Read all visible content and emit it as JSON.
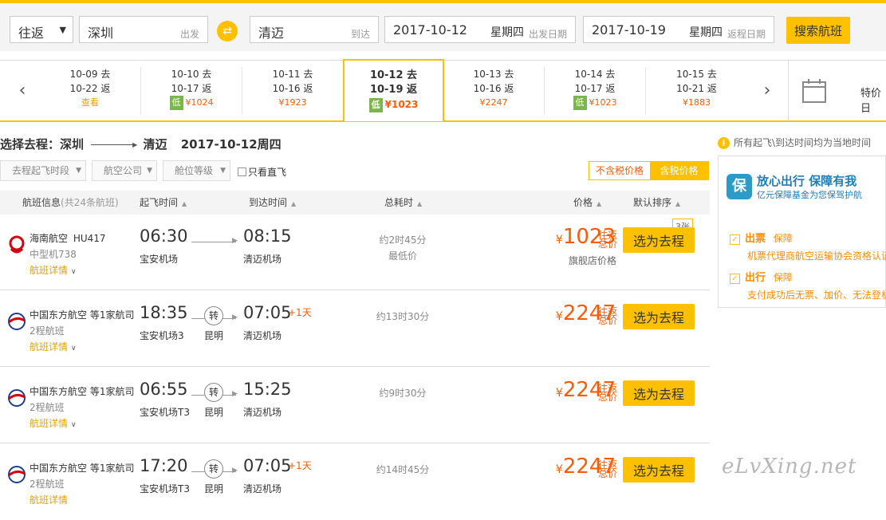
{
  "search": {
    "trip_type": "往返",
    "from": "深圳",
    "from_hint": "出发",
    "to": "清迈",
    "to_hint": "到达",
    "depart_date": "2017-10-12",
    "depart_weekday": "星期四",
    "depart_hint": "出发日期",
    "return_date": "2017-10-19",
    "return_weekday": "星期四",
    "return_hint": "返程日期",
    "search_label": "搜索航班"
  },
  "date_bar": {
    "cells": [
      {
        "go": "10-09 去",
        "ret": "10-22 返",
        "price": "查看",
        "low": ""
      },
      {
        "go": "10-10 去",
        "ret": "10-17 返",
        "price": "¥1024",
        "low": "低"
      },
      {
        "go": "10-11 去",
        "ret": "10-16 返",
        "price": "¥1923",
        "low": ""
      },
      {
        "go": "10-12 去",
        "ret": "10-19 返",
        "price": "¥1023",
        "low": "低"
      },
      {
        "go": "10-13 去",
        "ret": "10-16 返",
        "price": "¥2247",
        "low": ""
      },
      {
        "go": "10-14 去",
        "ret": "10-17 返",
        "price": "¥1023",
        "low": "低"
      },
      {
        "go": "10-15 去",
        "ret": "10-21 返",
        "price": "¥1883",
        "low": ""
      }
    ],
    "calendar_label": "特价日"
  },
  "section": {
    "title_prefix": "选择去程：深圳",
    "title_to": "清迈",
    "title_date": "2017-10-12周四"
  },
  "filters": {
    "time": "去程起飞时段",
    "airline": "航空公司",
    "cabin": "舱位等级",
    "direct": "只看直飞",
    "price_excl": "不含税价格",
    "price_incl": "含税价格"
  },
  "table_head": {
    "info": "航班信息",
    "count": "(共24条航班)",
    "depart": "起飞时间",
    "arrive": "到达时间",
    "duration": "总耗时",
    "price": "价格",
    "sort": "默认排序"
  },
  "flights": [
    {
      "airline": "海南航空",
      "code": "HU417",
      "sub": "中型机738",
      "detail": "航班详情",
      "dep": "06:30",
      "dep_ap": "宝安机场",
      "arr": "08:15",
      "arr_ap": "清迈机场",
      "plus": "",
      "stop": "",
      "stop_city": "",
      "dur": "约2时45分",
      "dur2": "最低价",
      "price": "1023",
      "rt": "往返总价",
      "note": "旗舰店价格",
      "badge": "3张",
      "btn": "选为去程"
    },
    {
      "airline": "中国东方航空 等1家航司",
      "code": "",
      "sub": "2程航班",
      "detail": "航班详情",
      "dep": "18:35",
      "dep_ap": "宝安机场3",
      "arr": "07:05",
      "arr_ap": "清迈机场",
      "plus": "+1天",
      "stop": "转",
      "stop_city": "昆明",
      "dur": "约13时30分",
      "dur2": "",
      "price": "2247",
      "rt": "往返总价",
      "note": "",
      "badge": "",
      "btn": "选为去程"
    },
    {
      "airline": "中国东方航空 等1家航司",
      "code": "",
      "sub": "2程航班",
      "detail": "航班详情",
      "dep": "06:55",
      "dep_ap": "宝安机场T3",
      "arr": "15:25",
      "arr_ap": "清迈机场",
      "plus": "",
      "stop": "转",
      "stop_city": "昆明",
      "dur": "约9时30分",
      "dur2": "",
      "price": "2247",
      "rt": "往返总价",
      "note": "",
      "badge": "",
      "btn": "选为去程"
    },
    {
      "airline": "中国东方航空 等1家航司",
      "code": "",
      "sub": "2程航班",
      "detail": "航班详情",
      "dep": "17:20",
      "dep_ap": "宝安机场T3",
      "arr": "07:05",
      "arr_ap": "清迈机场",
      "plus": "+1天",
      "stop": "转",
      "stop_city": "昆明",
      "dur": "约14时45分",
      "dur2": "",
      "price": "2247",
      "rt": "往返总价",
      "note": "",
      "badge": "",
      "btn": "选为去程"
    }
  ],
  "sidebar": {
    "notice": "所有起飞\\到达时间均为当地时间",
    "badge_char": "保",
    "title": "放心出行 保障有我",
    "subtitle": "亿元保障基金为您保驾护航",
    "items": [
      {
        "head": "出票",
        "tag": "保障",
        "desc": "机票代理商航空运输协会资格认证"
      },
      {
        "head": "出行",
        "tag": "保障",
        "desc": "支付成功后无票、加价、无法登机"
      }
    ]
  },
  "watermark": "eLvXing.net",
  "colors": {
    "accent": "#ffc000",
    "price": "#ff5a00",
    "low": "#7ab648"
  }
}
